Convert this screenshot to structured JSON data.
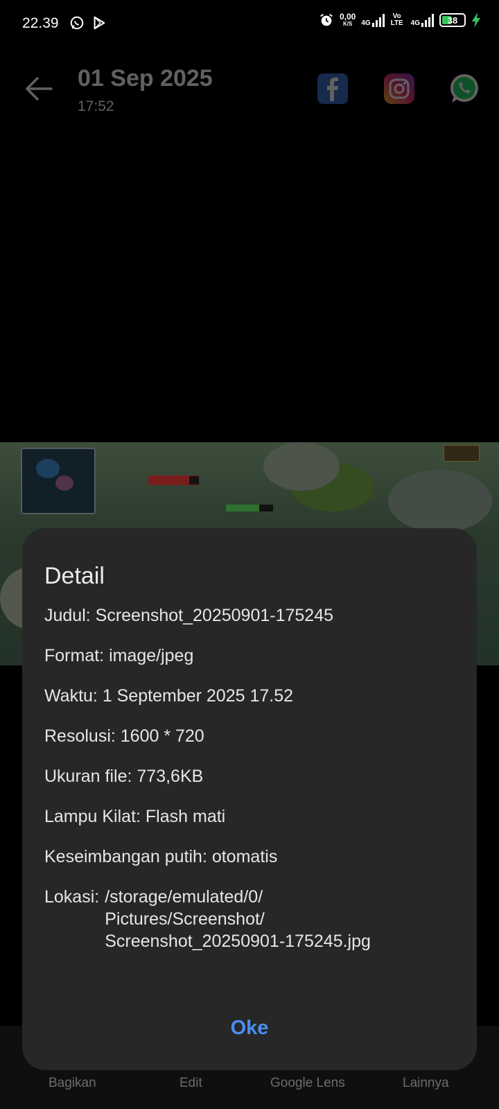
{
  "status_bar": {
    "time": "22.39",
    "net_speed_value": "0,00",
    "net_speed_unit": "K/S",
    "sim1_label": "4G",
    "volte_label": "Vo LTE",
    "sim2_label": "4G",
    "battery_level": "38",
    "battery_color": "#34c759"
  },
  "header": {
    "date": "01 Sep 2025",
    "time": "17:52"
  },
  "bottom_bar": {
    "items": [
      "Bagikan",
      "Edit",
      "Google Lens",
      "Lainnya"
    ]
  },
  "dialog": {
    "title": "Detail",
    "rows": [
      "Judul: Screenshot_20250901-175245",
      "Format: image/jpeg",
      "Waktu: 1 September 2025 17.52",
      "Resolusi: 1600 * 720",
      "Ukuran file: 773,6KB",
      "Lampu Kilat: Flash mati",
      "Keseimbangan putih: otomatis"
    ],
    "location_label": "Lokasi:",
    "location_lines": [
      "/storage/emulated/0/",
      "Pictures/Screenshot/",
      "Screenshot_20250901-175245.jpg"
    ],
    "ok_label": "Oke",
    "accent_color": "#4a8ff0"
  }
}
